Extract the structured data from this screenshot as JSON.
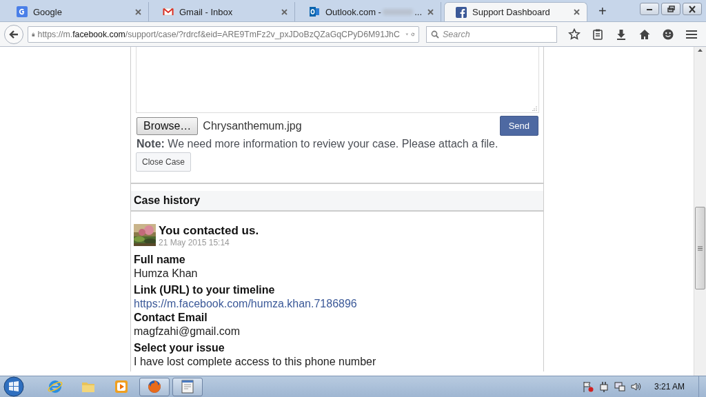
{
  "browser": {
    "tabs": [
      {
        "title": "Google",
        "selected": false
      },
      {
        "title": "Gmail - Inbox",
        "selected": false
      },
      {
        "title": "Outlook.com -",
        "suffix": "...",
        "selected": false
      },
      {
        "title": "Support Dashboard",
        "selected": true
      }
    ],
    "new_tab": "+",
    "url": {
      "scheme": "https://m.",
      "domain": "facebook.com",
      "path": "/support/case/?rdrcf&eid=ARE9TmFz2v_pxJDoBzQZaGqCPyD6M91JhC"
    },
    "search": {
      "placeholder": "Search"
    }
  },
  "reply_form": {
    "browse_button": "Browse…",
    "file_name": "Chrysanthemum.jpg",
    "send_button": "Send",
    "note": "**Note:** We need more information to review your case. Please attach a file.",
    "close_button": "Close Case"
  },
  "case_history": {
    "title": "Case history",
    "entry": {
      "title": "You contacted us.",
      "date": "21 May 2015 15:14",
      "fields": [
        {
          "label": "Full name",
          "value": "Humza Khan",
          "kind": "text"
        },
        {
          "label": "Link (URL) to your timeline",
          "value": "https://m.facebook.com/humza.khan.7186896",
          "kind": "link"
        },
        {
          "label": "Contact Email",
          "value": "magfzahi@gmail.com",
          "kind": "text"
        },
        {
          "label": "Select your issue",
          "value": "I have lost complete access to this phone number",
          "kind": "text"
        }
      ]
    }
  },
  "taskbar": {
    "apps": [
      {
        "kind": "ie",
        "running": false
      },
      {
        "kind": "folder",
        "running": false
      },
      {
        "kind": "media",
        "running": false
      },
      {
        "kind": "firefox",
        "running": true
      },
      {
        "kind": "window",
        "running": true
      }
    ],
    "clock": "3:21 AM"
  }
}
